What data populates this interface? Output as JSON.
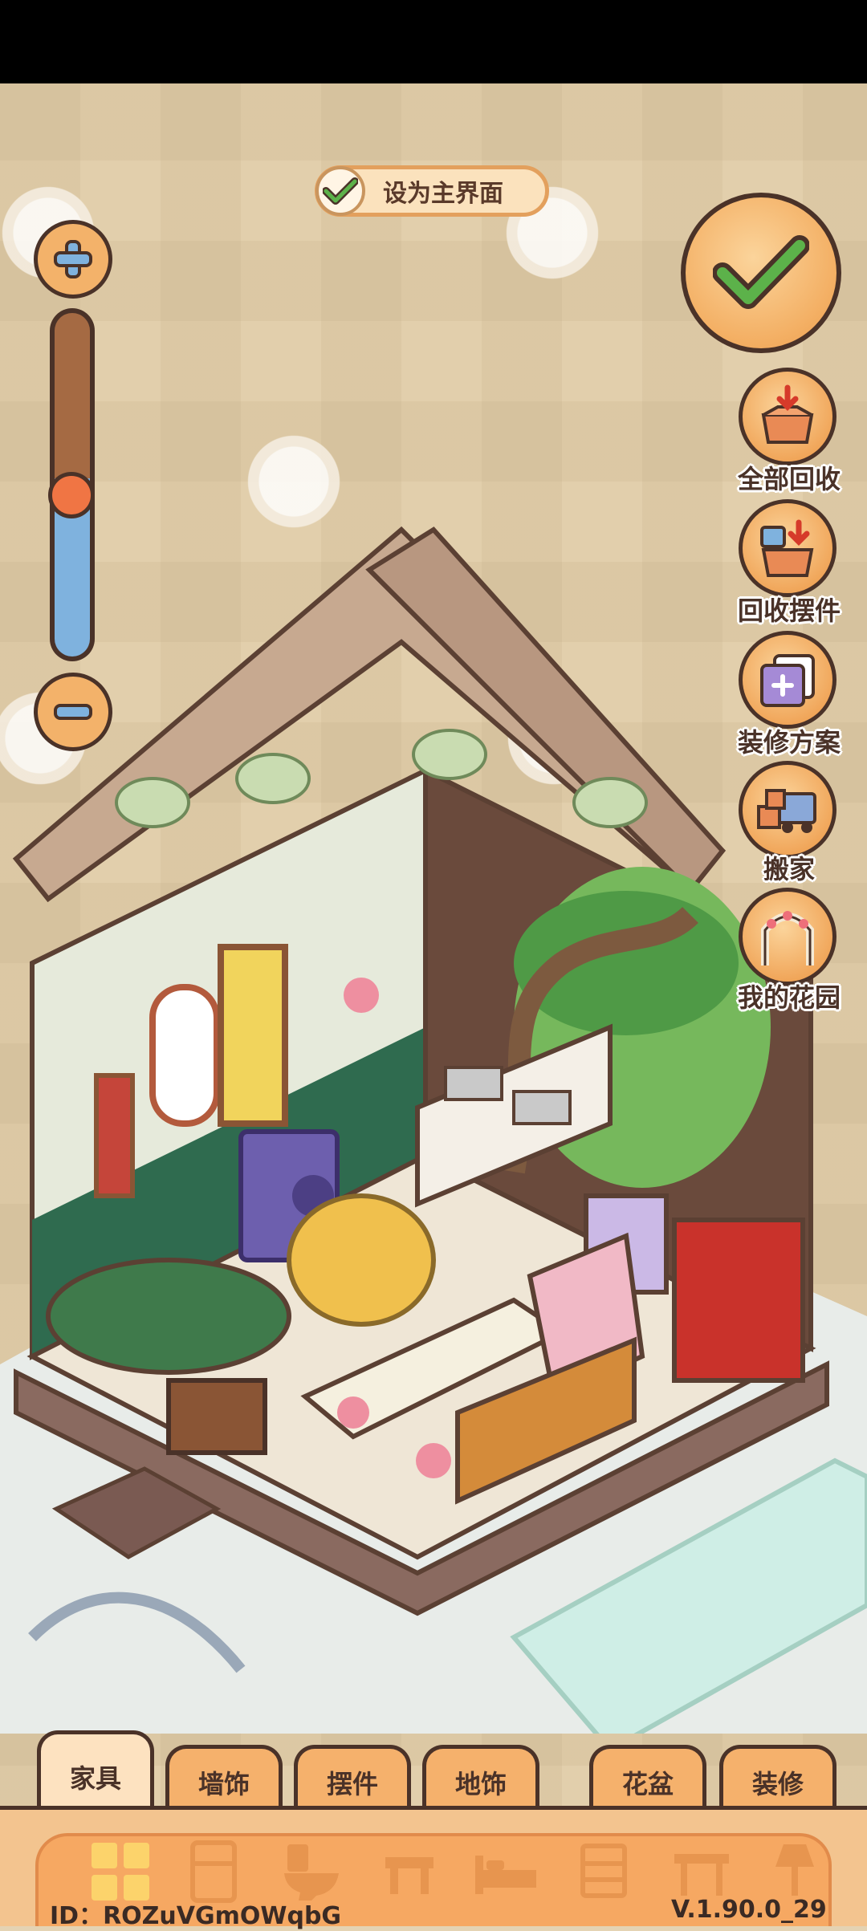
{
  "header": {
    "set_main_label": "设为主界面"
  },
  "side_menu": [
    {
      "label": "全部回收",
      "icon": "recycle-all-icon"
    },
    {
      "label": "回收摆件",
      "icon": "recycle-decor-icon"
    },
    {
      "label": "装修方案",
      "icon": "decor-plan-icon"
    },
    {
      "label": "搬家",
      "icon": "moving-truck-icon"
    },
    {
      "label": "我的花园",
      "icon": "garden-arch-icon"
    }
  ],
  "zoom": {
    "level": 0.47
  },
  "tabs": [
    {
      "label": "家具",
      "active": true
    },
    {
      "label": "墙饰",
      "active": false
    },
    {
      "label": "摆件",
      "active": false
    },
    {
      "label": "地饰",
      "active": false
    },
    {
      "label": "花盆",
      "active": false
    },
    {
      "label": "装修",
      "active": false
    }
  ],
  "categories": [
    "all-grid-icon",
    "fridge-icon",
    "toilet-icon",
    "stool-icon",
    "bed-icon",
    "cabinet-icon",
    "table-icon",
    "lamp-icon"
  ],
  "footer": {
    "id_text": "ID：ROZuVGmOWqbG",
    "version_text": "V.1.90.0_29"
  },
  "colors": {
    "accent": "#f3b26a",
    "outline": "#4a3228",
    "check_green": "#5cb24a"
  }
}
